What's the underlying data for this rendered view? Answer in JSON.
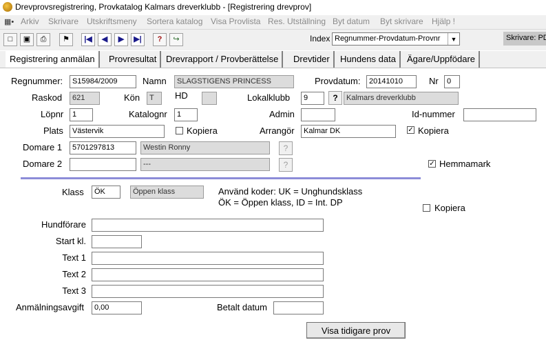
{
  "window": {
    "title": "Drevprovsregistrering, Provkatalog  Kalmars dreverklubb - [Registrering drevprov]"
  },
  "menu": {
    "items": [
      "Arkiv",
      "Skrivare",
      "Utskriftsmeny",
      "Sortera katalog",
      "Visa Provlista",
      "Res. Utställning",
      "Byt datum",
      "Byt skrivare",
      "Hjälp !"
    ]
  },
  "toolbar": {
    "index_label": "Index",
    "index_value": "Regnummer-Provdatum-Provnr",
    "printer_label": "Skrivare: PDF"
  },
  "tabs": [
    "Registrering anmälan",
    "Provresultat",
    "Drevrapport / Provberättelse",
    "Drevtider",
    "Hundens data",
    "Ägare/Uppfödare"
  ],
  "form": {
    "regnummer_label": "Regnummer:",
    "regnummer": "S15984/2009",
    "namn_label": "Namn",
    "namn": "SLAGSTIGENS PRINCESS",
    "provdatum_label": "Provdatum:",
    "provdatum": "20141010",
    "nr_label": "Nr",
    "nr": "0",
    "raskod_label": "Raskod",
    "raskod": "621",
    "kon_label": "Kön",
    "kon": "T",
    "hd_label": "HD",
    "hd": "",
    "lokalklubb_label": "Lokalklubb",
    "lokalklubb": "9",
    "lokalklubb_name": "Kalmars dreverklubb",
    "lopnr_label": "Löpnr",
    "lopnr": "1",
    "katalognr_label": "Katalognr",
    "katalognr": "1",
    "admin_label": "Admin",
    "admin": "",
    "idnummer_label": "Id-nummer",
    "idnummer": "",
    "plats_label": "Plats",
    "plats": "Västervik",
    "kopiera_label": "Kopiera",
    "arrangor_label": "Arrangör",
    "arrangor": "Kalmar DK",
    "domare1_label": "Domare 1",
    "domare1": "5701297813",
    "domare1_name": "Westin Ronny",
    "domare2_label": "Domare 2",
    "domare2": "",
    "domare2_name": "---",
    "hemmamark_label": "Hemmamark",
    "question": "?",
    "klass_label": "Klass",
    "klass": "ÖK",
    "klass_name": "Öppen klass",
    "klass_help_1": "Använd koder: UK =  Unghundsklass",
    "klass_help_2": "ÖK = Öppen klass, ID = Int. DP",
    "hundforare_label": "Hundförare",
    "hundforare": "",
    "startkl_label": "Start kl.",
    "startkl": "",
    "text1_label": "Text 1",
    "text1": "",
    "text2_label": "Text 2",
    "text2": "",
    "text3_label": "Text 3",
    "text3": "",
    "avgift_label": "Anmälningsavgift",
    "avgift": "0,00",
    "betalt_label": "Betalt datum",
    "betalt": "",
    "visa_button": "Visa tidigare prov"
  },
  "checks": {
    "kopiera_plats": false,
    "kopiera_arrangor": true,
    "hemmamark": true,
    "kopiera_klass": false
  }
}
